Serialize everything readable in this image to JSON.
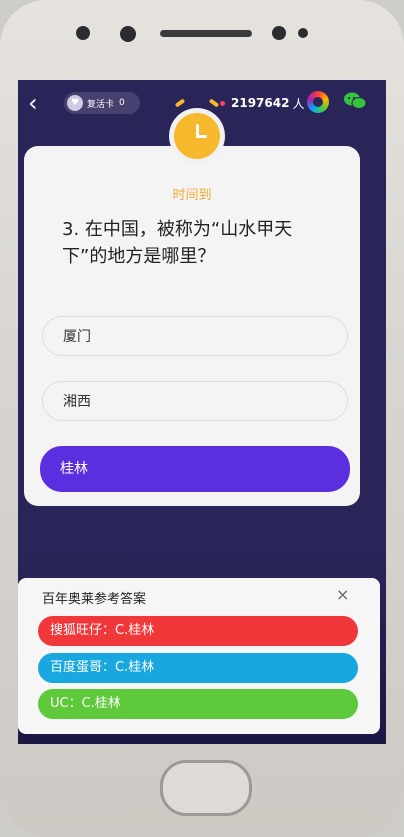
{
  "topbar": {
    "back_icon": "chevron-left-icon",
    "revive_label": "复活卡",
    "revive_count": "0",
    "online_count": "2197642",
    "online_unit": "人"
  },
  "question": {
    "status": "时间到",
    "text": "3. 在中国，被称为“山水甲天下”的地方是哪里？",
    "options": [
      "厦门",
      "湘西",
      "桂林"
    ],
    "selected_index": 2
  },
  "answers_panel": {
    "title": "百年奥莱参考答案",
    "close": "×",
    "items": [
      {
        "label": "搜狐旺仔：C.桂林",
        "color": "#f0383a"
      },
      {
        "label": "百度蛋哥：C.桂林",
        "color": "#19a7e0"
      },
      {
        "label": "UC：C.桂林",
        "color": "#5ec93a"
      }
    ]
  },
  "colors": {
    "accent": "#5b2ee0",
    "clock": "#f6b82d",
    "screen_bg": "#2a2558"
  }
}
